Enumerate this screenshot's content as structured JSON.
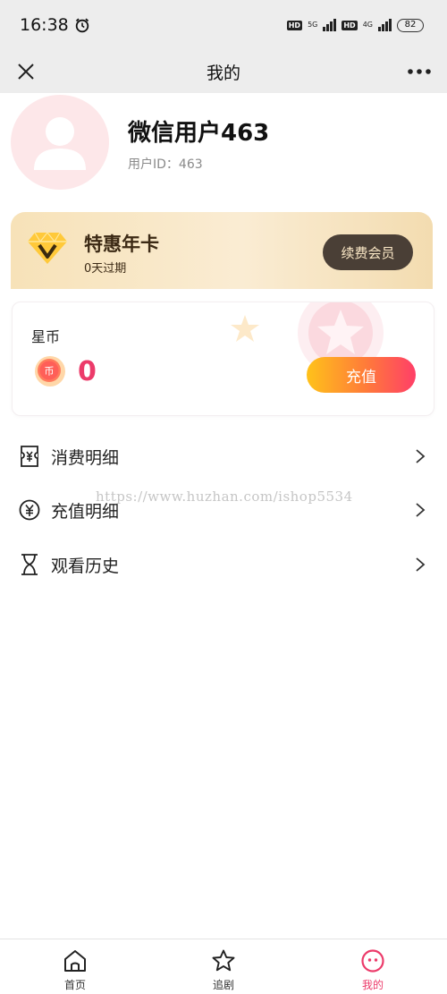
{
  "status_bar": {
    "time": "16:38",
    "hd1": "HD",
    "net1": "5G",
    "hd2": "HD",
    "net2": "4G",
    "battery": "82"
  },
  "nav": {
    "title": "我的"
  },
  "profile": {
    "name": "微信用户463",
    "id_label": "用户ID：463"
  },
  "vip": {
    "title": "特惠年卡",
    "subtitle": "0天过期",
    "renew_label": "续费会员",
    "colors": {
      "card": "#f7e2b8",
      "button": "#4a3f36",
      "button_text": "#fbe8c6"
    }
  },
  "coins": {
    "label": "星币",
    "value": "0",
    "coin_glyph": "币",
    "recharge_label": "充值",
    "colors": {
      "value": "#ec3b6a",
      "button_from": "#ffc21a",
      "button_to": "#ff3f68"
    }
  },
  "menu": [
    {
      "label": "消费明细",
      "icon": "receipt-icon"
    },
    {
      "label": "充值明细",
      "icon": "yuan-circle-icon"
    },
    {
      "label": "观看历史",
      "icon": "hourglass-icon"
    }
  ],
  "watermark": "https://www.huzhan.com/ishop5534",
  "tabs": [
    {
      "label": "首页",
      "icon": "home-icon",
      "active": false
    },
    {
      "label": "追剧",
      "icon": "star-icon",
      "active": false
    },
    {
      "label": "我的",
      "icon": "smile-icon",
      "active": true
    }
  ],
  "accent_color": "#ec3b6a"
}
